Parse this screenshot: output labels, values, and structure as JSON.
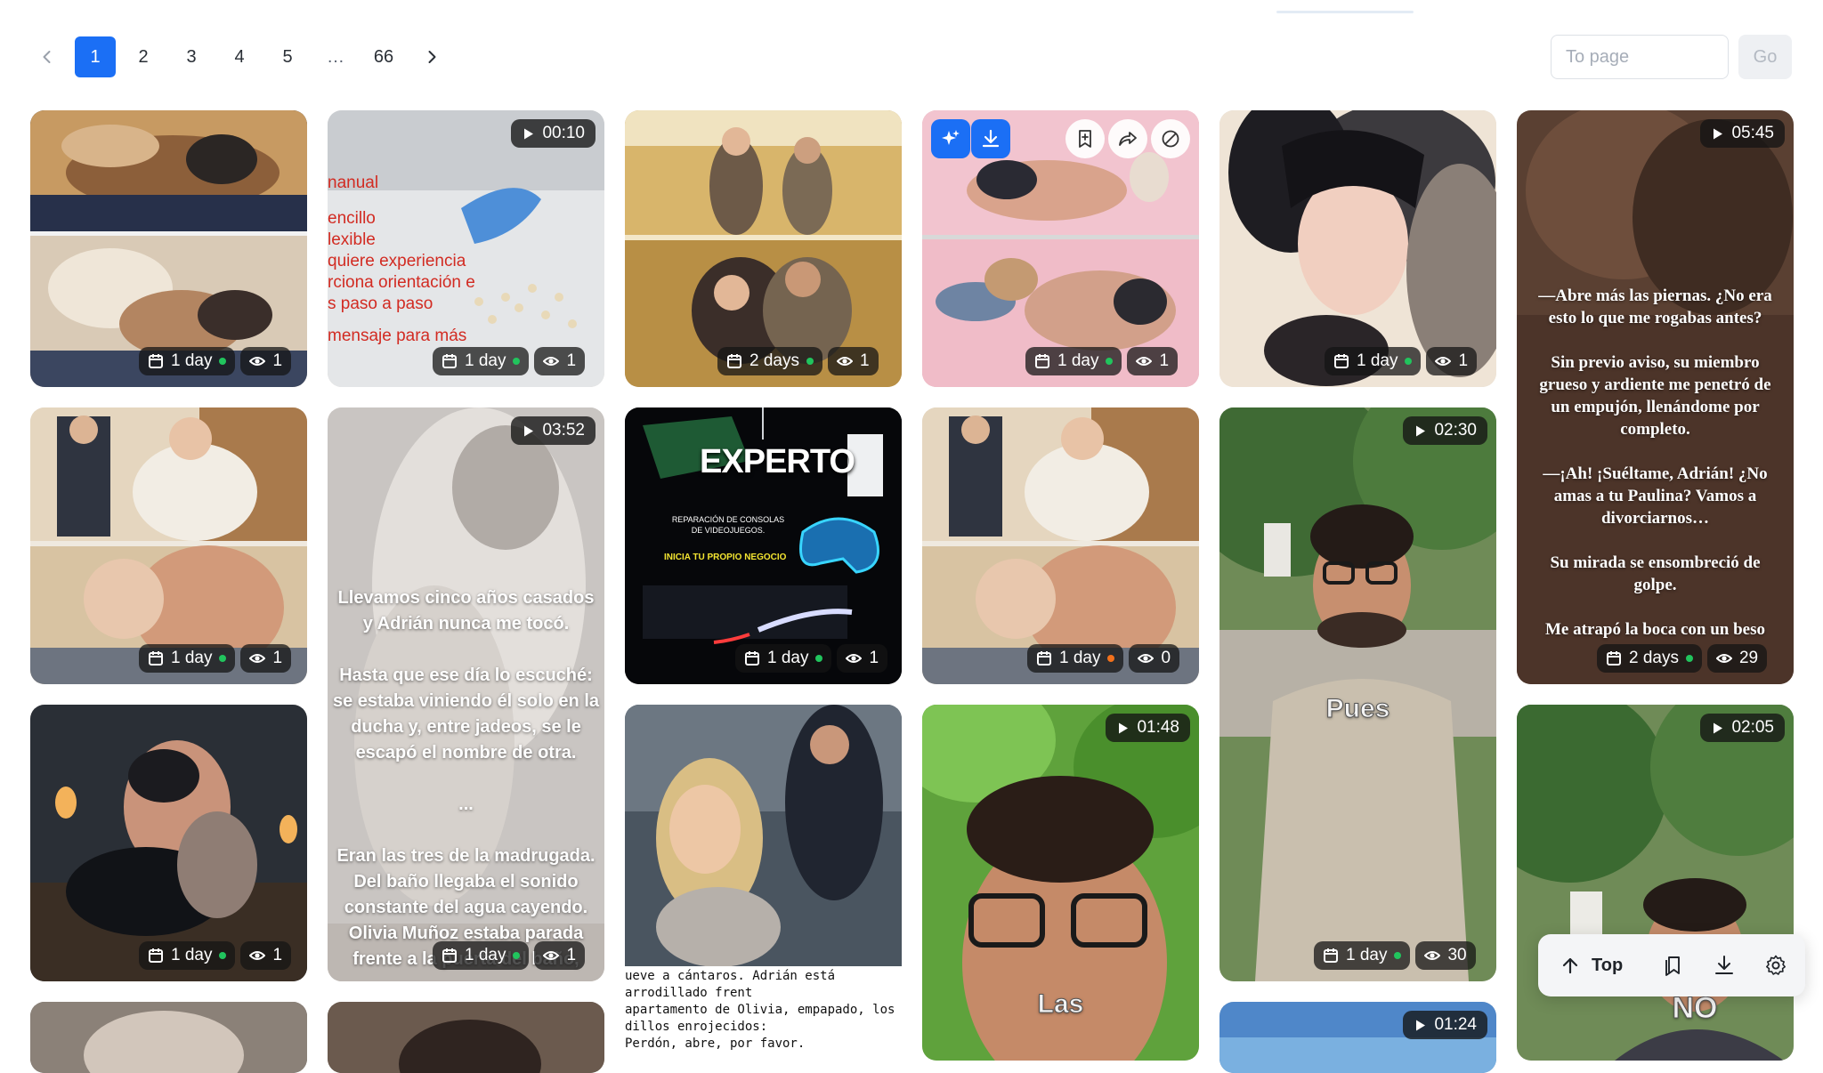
{
  "pagination": {
    "pages": [
      "1",
      "2",
      "3",
      "4",
      "5",
      "…",
      "66"
    ],
    "current": "1",
    "to_page_placeholder": "To page",
    "go_label": "Go"
  },
  "cards": [
    {
      "age": "1 day",
      "views": "1"
    },
    {
      "duration": "00:10",
      "age": "1 day",
      "views": "1",
      "text": [
        "nanual",
        "encillo",
        "lexible",
        "quiere experiencia",
        "rciona orientación e",
        "s paso a paso",
        "mensaje para más"
      ]
    },
    {
      "age": "2 days",
      "views": "1"
    },
    {
      "age": "1 day",
      "views": "1"
    },
    {
      "age": "1 day",
      "views": "1"
    },
    {
      "duration": "05:45",
      "age": "2 days",
      "views": "29",
      "text": "—Abre más las piernas. ¿No era esto lo que me rogabas antes?\n\nSin previo aviso, su miembro grueso y ardiente me penetró de un empujón, llenándome por completo.\n\n—¡Ah! ¡Suéltame, Adrián! ¿No amas a tu Paulina? Vamos a divorciarnos…\n\nSu mirada se ensombreció de golpe.\n\nMe atrapó la boca con un beso"
    },
    {
      "age": "1 day",
      "views": "1"
    },
    {
      "duration": "03:52",
      "age": "1 day",
      "views": "1",
      "text": "Llevamos cinco años casados y Adrián nunca me tocó.\n\nHasta que ese día lo escuché: se estaba viniendo él solo en la ducha y, entre jadeos, se le escapó el nombre de otra.\n\n...\n\nEran las tres de la madrugada. Del baño llegaba el sonido constante del agua cayendo. Olivia Muñoz estaba parada frente a la puerta del baño,"
    },
    {
      "age": "1 day",
      "views": "1",
      "title": "EXPERTO",
      "sub": "REPARACIÓN DE CONSOLAS DE VIDEOJUEGOS.",
      "cta": "INICIA TU PROPIO NEGOCIO"
    },
    {
      "age": "1 day",
      "views": "0"
    },
    {
      "duration": "02:30",
      "age": "1 day",
      "views": "30",
      "caption": "Pues"
    },
    {
      "duration": "02:05",
      "caption": "NO"
    },
    {
      "age": "1 day",
      "views": "1"
    },
    {
      "caption_text": [
        "ueve a cántaros. Adrián está arrodillado frent",
        "apartamento de Olivia, empapado, los",
        "dillos enrojecidos:",
        "Perdón, abre, por favor."
      ]
    },
    {
      "duration": "01:48",
      "caption": "Las"
    },
    {
      "duration": "01:24"
    }
  ],
  "floatbar": {
    "top_label": "Top"
  },
  "colors": {
    "accent": "#1b6ff5",
    "fresh_dot": "#21c45d",
    "new_dot": "#f2711c"
  }
}
